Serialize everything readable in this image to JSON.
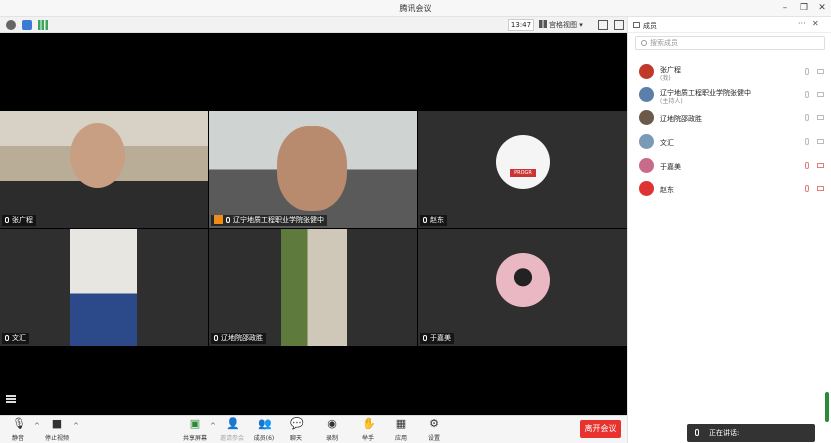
{
  "window": {
    "title": "腾讯会议"
  },
  "toolbar": {
    "time": "13:47",
    "view_label": "宫格视图"
  },
  "participants_panel": {
    "title": "成员",
    "search_placeholder": "搜索成员",
    "members": [
      {
        "name": "张广程",
        "role": "(我)",
        "mic": "on",
        "camera": "on",
        "avatar_color": "#c0392b"
      },
      {
        "name": "辽宁地质工程职业学院张健中",
        "role": "(主持人)",
        "mic": "on",
        "camera": "on",
        "avatar_color": "#5a7fa8"
      },
      {
        "name": "辽地院邵政胜",
        "role": "",
        "mic": "on",
        "camera": "on",
        "avatar_color": "#6b5a4a"
      },
      {
        "name": "文汇",
        "role": "",
        "mic": "on",
        "camera": "on",
        "avatar_color": "#7a9ab8"
      },
      {
        "name": "于嘉美",
        "role": "",
        "mic": "muted",
        "camera": "muted",
        "avatar_color": "#c86a8a"
      },
      {
        "name": "赵东",
        "role": "",
        "mic": "muted",
        "camera": "muted",
        "avatar_color": "#d33"
      }
    ]
  },
  "video_tiles": [
    {
      "label": "张广程",
      "host": false
    },
    {
      "label": "辽宁地质工程职业学院张健中",
      "host": true
    },
    {
      "label": "赵东",
      "host": false,
      "avatar_text": "PROGR"
    },
    {
      "label": "文汇",
      "host": false
    },
    {
      "label": "辽地院邵政胜",
      "host": false
    },
    {
      "label": "于嘉美",
      "host": false
    }
  ],
  "controls": {
    "mute": "静音",
    "stop_video": "停止视频",
    "share_screen": "共享屏幕",
    "invite": "邀请参会",
    "members": "成员(6)",
    "chat": "聊天",
    "record": "录制",
    "raise_hand": "举手",
    "apps": "应用",
    "settings": "设置",
    "leave": "离开会议"
  },
  "status": {
    "talking": "正在讲话:"
  },
  "colors": {
    "leave_button": "#e8322e",
    "host_badge": "#f08c1a",
    "muted": "#e57c7c"
  }
}
